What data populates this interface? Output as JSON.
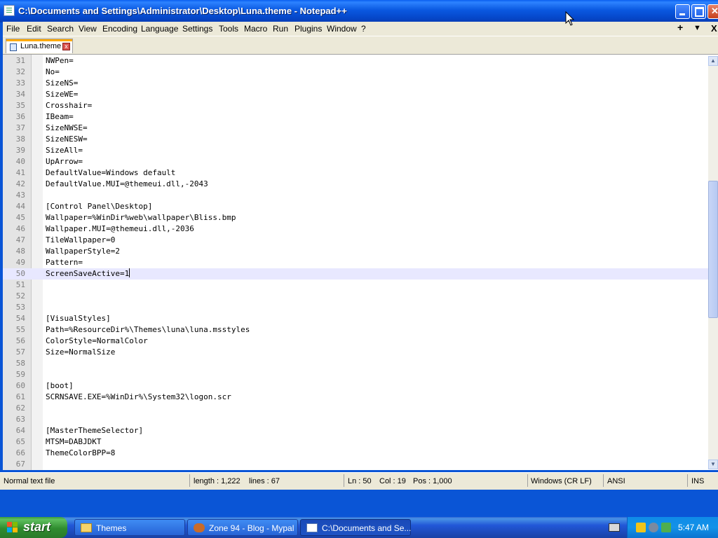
{
  "window": {
    "title": "C:\\Documents and Settings\\Administrator\\Desktop\\Luna.theme - Notepad++"
  },
  "menu": {
    "items": [
      "File",
      "Edit",
      "Search",
      "View",
      "Encoding",
      "Language",
      "Settings",
      "Tools",
      "Macro",
      "Run",
      "Plugins",
      "Window",
      "?"
    ],
    "right": [
      "+",
      "▼",
      "X"
    ]
  },
  "tabs": [
    {
      "label": "Luna.theme",
      "active": true
    }
  ],
  "editor": {
    "current_line": 50,
    "lines": [
      {
        "n": "31",
        "text": "NWPen="
      },
      {
        "n": "32",
        "text": "No="
      },
      {
        "n": "33",
        "text": "SizeNS="
      },
      {
        "n": "34",
        "text": "SizeWE="
      },
      {
        "n": "35",
        "text": "Crosshair="
      },
      {
        "n": "36",
        "text": "IBeam="
      },
      {
        "n": "37",
        "text": "SizeNWSE="
      },
      {
        "n": "38",
        "text": "SizeNESW="
      },
      {
        "n": "39",
        "text": "SizeAll="
      },
      {
        "n": "40",
        "text": "UpArrow="
      },
      {
        "n": "41",
        "text": "DefaultValue=Windows default"
      },
      {
        "n": "42",
        "text": "DefaultValue.MUI=@themeui.dll,-2043"
      },
      {
        "n": "43",
        "text": ""
      },
      {
        "n": "44",
        "text": "[Control Panel\\Desktop]"
      },
      {
        "n": "45",
        "text": "Wallpaper=%WinDir%web\\wallpaper\\Bliss.bmp"
      },
      {
        "n": "46",
        "text": "Wallpaper.MUI=@themeui.dll,-2036"
      },
      {
        "n": "47",
        "text": "TileWallpaper=0"
      },
      {
        "n": "48",
        "text": "WallpaperStyle=2"
      },
      {
        "n": "49",
        "text": "Pattern="
      },
      {
        "n": "50",
        "text": "ScreenSaveActive=1"
      },
      {
        "n": "51",
        "text": ""
      },
      {
        "n": "52",
        "text": ""
      },
      {
        "n": "53",
        "text": ""
      },
      {
        "n": "54",
        "text": "[VisualStyles]"
      },
      {
        "n": "55",
        "text": "Path=%ResourceDir%\\Themes\\luna\\luna.msstyles"
      },
      {
        "n": "56",
        "text": "ColorStyle=NormalColor"
      },
      {
        "n": "57",
        "text": "Size=NormalSize"
      },
      {
        "n": "58",
        "text": ""
      },
      {
        "n": "59",
        "text": ""
      },
      {
        "n": "60",
        "text": "[boot]"
      },
      {
        "n": "61",
        "text": "SCRNSAVE.EXE=%WinDir%\\System32\\logon.scr"
      },
      {
        "n": "62",
        "text": ""
      },
      {
        "n": "63",
        "text": ""
      },
      {
        "n": "64",
        "text": "[MasterThemeSelector]"
      },
      {
        "n": "65",
        "text": "MTSM=DABJDKT"
      },
      {
        "n": "66",
        "text": "ThemeColorBPP=8"
      },
      {
        "n": "67",
        "text": ""
      }
    ]
  },
  "scrollbar": {
    "up": "▲",
    "down": "▼"
  },
  "status": {
    "file_type": "Normal text file",
    "length": "length : 1,222",
    "lines": "lines : 67",
    "ln": "Ln : 50",
    "col": "Col : 19",
    "pos": "Pos : 1,000",
    "eol": "Windows (CR LF)",
    "encoding": "ANSI",
    "mode": "INS"
  },
  "taskbar": {
    "start_label": "start",
    "tasks": [
      {
        "label": "Themes",
        "active": false
      },
      {
        "label": "Zone 94 - Blog - Mypal",
        "active": false
      },
      {
        "label": "C:\\Documents and Se...",
        "active": true
      }
    ],
    "clock": "5:47 AM"
  },
  "colors": {
    "title_blue": "#0a55d6",
    "current_line": "#e8e8ff",
    "start_green": "#3c9b3c"
  }
}
